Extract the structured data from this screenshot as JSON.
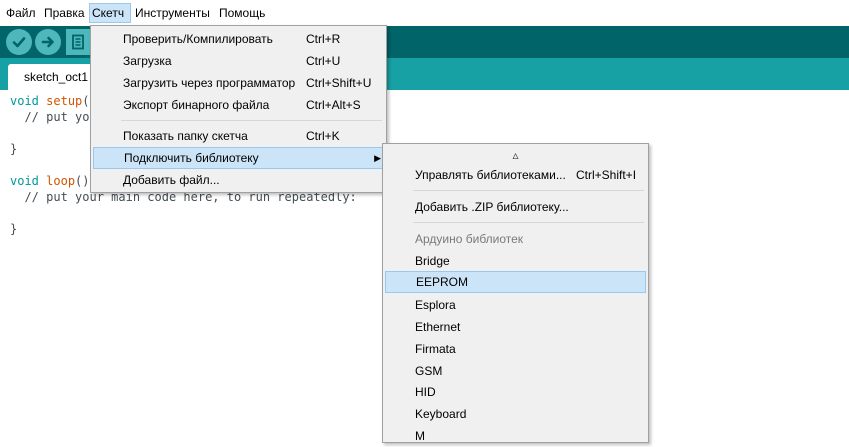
{
  "menubar": {
    "items": [
      {
        "label": "Файл"
      },
      {
        "label": "Правка"
      },
      {
        "label": "Скетч"
      },
      {
        "label": "Инструменты"
      },
      {
        "label": "Помощь"
      }
    ]
  },
  "toolbar": {
    "verify_icon": "check-icon",
    "upload_icon": "arrow-right-icon",
    "new_icon": "document-icon"
  },
  "tab": {
    "label": "sketch_oct1"
  },
  "editor": {
    "lines": [
      {
        "kw": "void",
        "fn": "setup",
        "rest": "("
      },
      {
        "text": "  // put yo"
      },
      {
        "text": ""
      },
      {
        "text": "}"
      },
      {
        "text": ""
      },
      {
        "kw": "void",
        "fn": "loop",
        "rest": "()"
      },
      {
        "text": "  // put your main code here, to run repeatedly:"
      },
      {
        "text": ""
      },
      {
        "text": "}"
      }
    ]
  },
  "sketch_menu": {
    "items": [
      {
        "label": "Проверить/Компилировать",
        "shortcut": "Ctrl+R"
      },
      {
        "label": "Загрузка",
        "shortcut": "Ctrl+U"
      },
      {
        "label": "Загрузить через программатор",
        "shortcut": "Ctrl+Shift+U"
      },
      {
        "label": "Экспорт бинарного файла",
        "shortcut": "Ctrl+Alt+S"
      },
      {
        "label": "Показать папку скетча",
        "shortcut": "Ctrl+K"
      },
      {
        "label": "Подключить библиотеку",
        "shortcut": ""
      },
      {
        "label": "Добавить файл...",
        "shortcut": ""
      }
    ]
  },
  "library_menu": {
    "scroll_up": "▵",
    "manage": {
      "label": "Управлять библиотеками...",
      "shortcut": "Ctrl+Shift+I"
    },
    "add_zip": {
      "label": "Добавить .ZIP библиотеку..."
    },
    "section_header": "Ардуино библиотек",
    "libraries": [
      "Bridge",
      "EEPROM",
      "Esplora",
      "Ethernet",
      "Firmata",
      "GSM",
      "HID",
      "Keyboard",
      "M"
    ]
  },
  "colors": {
    "toolbar": "#006468",
    "tabbar": "#17a1a5",
    "button": "#4db7bb",
    "highlight": "#cce4f7"
  }
}
